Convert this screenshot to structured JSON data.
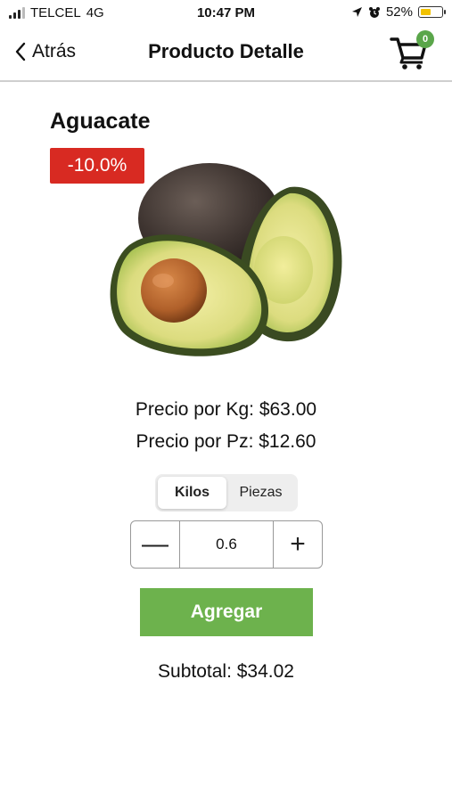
{
  "status_bar": {
    "carrier": "TELCEL",
    "network": "4G",
    "time": "10:47 PM",
    "battery": "52%",
    "battery_level": 0.52
  },
  "nav": {
    "back_label": "Atrás",
    "title": "Producto Detalle",
    "cart_count": "0"
  },
  "product": {
    "name": "Aguacate",
    "discount": "-10.0%",
    "price_per_kg": "Precio por Kg: $63.00",
    "price_per_pz": "Precio por Pz: $12.60"
  },
  "units": {
    "options": [
      "Kilos",
      "Piezas"
    ],
    "selected": "Kilos"
  },
  "quantity": {
    "value": "0.6",
    "decrement": "—",
    "increment": "+"
  },
  "add_button": "Agregar",
  "subtotal": "Subtotal: $34.02",
  "colors": {
    "accent_green": "#6db24d",
    "discount_red": "#d82a22",
    "badge_green": "#5aa64a"
  }
}
